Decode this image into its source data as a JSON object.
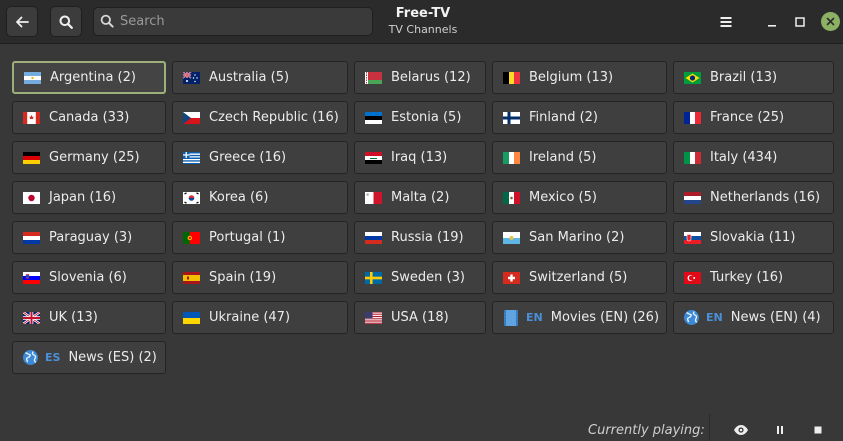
{
  "header": {
    "back_icon": "arrow-left-icon",
    "search_toggle_icon": "search-icon",
    "search": {
      "placeholder": "Search",
      "value": ""
    },
    "title": "Free-TV",
    "subtitle": "TV Channels",
    "menu_icon": "hamburger-menu-icon",
    "minimize_icon": "minimize-icon",
    "maximize_icon": "maximize-icon",
    "close_icon": "close-icon",
    "close_color": "#8cb163"
  },
  "channels": [
    {
      "label": "Argentina (2)",
      "flag": "argentina",
      "selected": true
    },
    {
      "label": "Australia (5)",
      "flag": "australia"
    },
    {
      "label": "Belarus (12)",
      "flag": "belarus"
    },
    {
      "label": "Belgium (13)",
      "flag": "belgium"
    },
    {
      "label": "Brazil (13)",
      "flag": "brazil"
    },
    {
      "label": "Canada (33)",
      "flag": "canada"
    },
    {
      "label": "Czech Republic (16)",
      "flag": "czech"
    },
    {
      "label": "Estonia (5)",
      "flag": "estonia"
    },
    {
      "label": "Finland (2)",
      "flag": "finland"
    },
    {
      "label": "France (25)",
      "flag": "france"
    },
    {
      "label": "Germany (25)",
      "flag": "germany"
    },
    {
      "label": "Greece (16)",
      "flag": "greece"
    },
    {
      "label": "Iraq (13)",
      "flag": "iraq"
    },
    {
      "label": "Ireland (5)",
      "flag": "ireland"
    },
    {
      "label": "Italy (434)",
      "flag": "italy"
    },
    {
      "label": "Japan (16)",
      "flag": "japan"
    },
    {
      "label": "Korea (6)",
      "flag": "korea"
    },
    {
      "label": "Malta (2)",
      "flag": "malta"
    },
    {
      "label": "Mexico (5)",
      "flag": "mexico"
    },
    {
      "label": "Netherlands (16)",
      "flag": "netherlands"
    },
    {
      "label": "Paraguay (3)",
      "flag": "paraguay"
    },
    {
      "label": "Portugal (1)",
      "flag": "portugal"
    },
    {
      "label": "Russia (19)",
      "flag": "russia"
    },
    {
      "label": "San Marino (2)",
      "flag": "san-marino"
    },
    {
      "label": "Slovakia (11)",
      "flag": "slovakia"
    },
    {
      "label": "Slovenia (6)",
      "flag": "slovenia"
    },
    {
      "label": "Spain (19)",
      "flag": "spain"
    },
    {
      "label": "Sweden (3)",
      "flag": "sweden"
    },
    {
      "label": "Switzerland (5)",
      "flag": "switzerland"
    },
    {
      "label": "Turkey (16)",
      "flag": "turkey"
    },
    {
      "label": "UK (13)",
      "flag": "uk"
    },
    {
      "label": "Ukraine (47)",
      "flag": "ukraine"
    },
    {
      "label": "USA (18)",
      "flag": "usa"
    },
    {
      "label": "Movies (EN) (26)",
      "icon": "film-icon",
      "lang": "EN"
    },
    {
      "label": "News (EN) (4)",
      "icon": "globe-icon",
      "lang": "EN"
    },
    {
      "label": "News (ES) (2)",
      "icon": "globe-icon",
      "lang": "ES"
    }
  ],
  "footer": {
    "currently_playing_label": "Currently playing:",
    "watch_icon": "eye-icon",
    "pause_icon": "pause-icon",
    "stop_icon": "stop-icon"
  }
}
